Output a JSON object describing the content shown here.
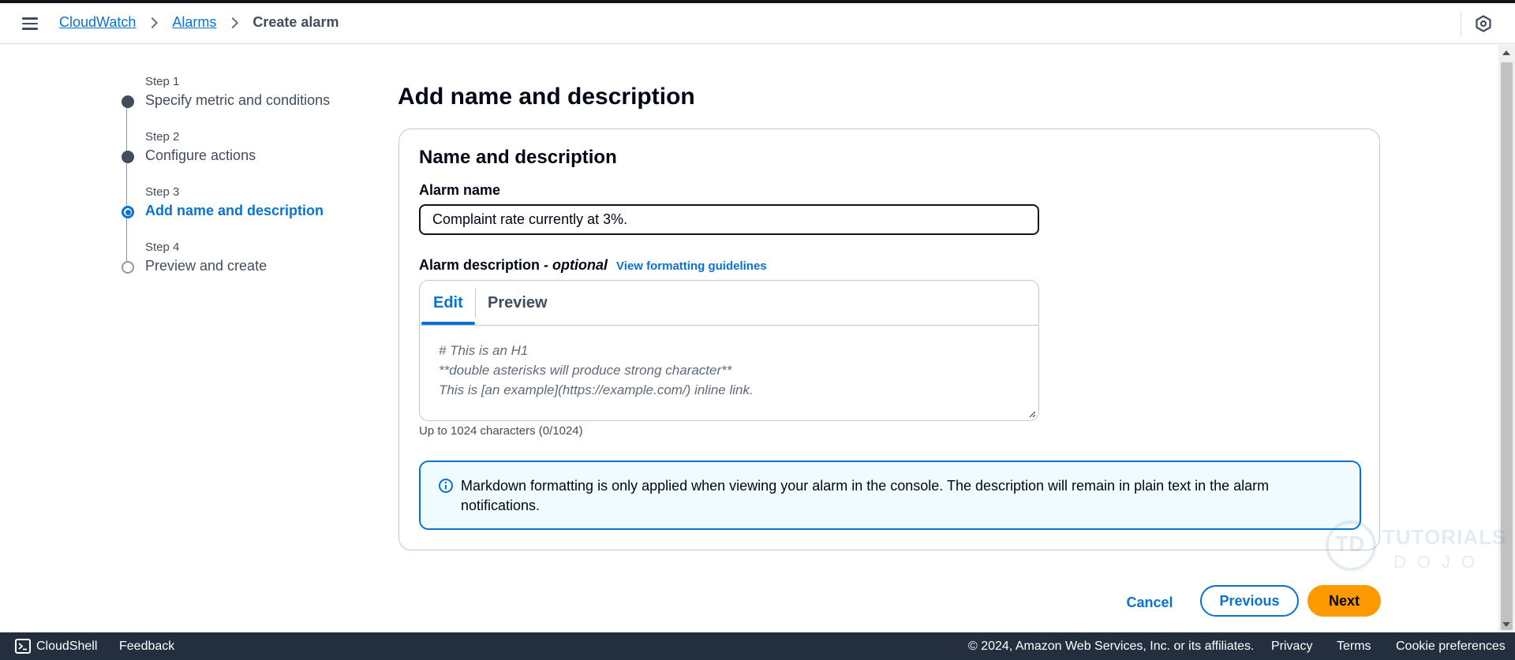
{
  "breadcrumb": {
    "items": [
      "CloudWatch",
      "Alarms"
    ],
    "current": "Create alarm"
  },
  "steps": [
    {
      "num": "Step 1",
      "title": "Specify metric and conditions",
      "state": "done"
    },
    {
      "num": "Step 2",
      "title": "Configure actions",
      "state": "done"
    },
    {
      "num": "Step 3",
      "title": "Add name and description",
      "state": "active"
    },
    {
      "num": "Step 4",
      "title": "Preview and create",
      "state": "todo"
    }
  ],
  "page": {
    "title": "Add name and description"
  },
  "card": {
    "title": "Name and description",
    "alarm_name_label": "Alarm name",
    "alarm_name_value": "Complaint rate currently at 3%.",
    "description_label": "Alarm description - ",
    "description_optional": "optional",
    "guidelines_link": "View formatting guidelines",
    "tabs": {
      "edit": "Edit",
      "preview": "Preview"
    },
    "placeholder_lines": [
      "# This is an H1",
      "**double asterisks will produce strong character**",
      "This is [an example](https://example.com/) inline link."
    ],
    "char_hint": "Up to 1024 characters (0/1024)",
    "info_text": "Markdown formatting is only applied when viewing your alarm in the console. The description will remain in plain text in the alarm notifications."
  },
  "actions": {
    "cancel": "Cancel",
    "previous": "Previous",
    "next": "Next"
  },
  "watermark": {
    "line1": "TUTORIALS",
    "line2": "DOJO",
    "mark": "TD"
  },
  "footer": {
    "cloudshell": "CloudShell",
    "feedback": "Feedback",
    "copyright": "© 2024, Amazon Web Services, Inc. or its affiliates.",
    "privacy": "Privacy",
    "terms": "Terms",
    "cookies": "Cookie preferences"
  },
  "colors": {
    "link_blue": "#0972d3",
    "primary_orange": "#ff9900",
    "footer_bg": "#232f3e",
    "info_bg": "#f0fbff"
  },
  "icons": {
    "menu": "hamburger-menu-icon",
    "header_right": "settings-hexagon-icon",
    "info": "info-circle-icon",
    "cloudshell": "terminal-icon"
  }
}
